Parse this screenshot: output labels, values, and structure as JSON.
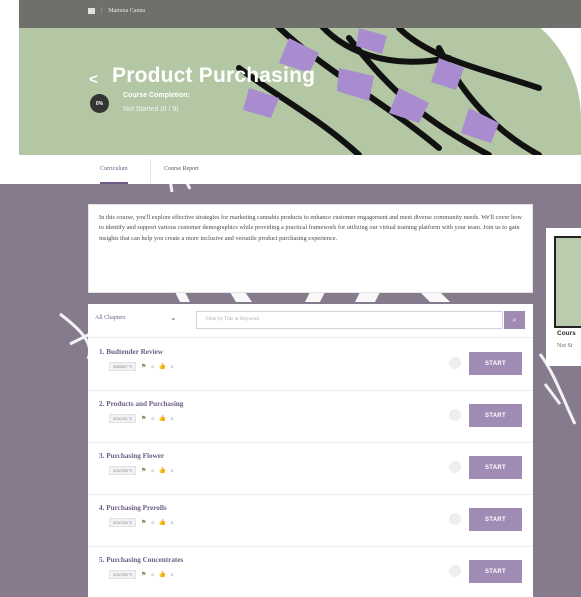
{
  "breadcrumb": {
    "site": "Mamma Canna"
  },
  "hero": {
    "back_label": "<",
    "title": "Product Purchasing",
    "progress_percent": "0%",
    "completion_label": "Course Completion:",
    "completion_status": "Not Started (0 / 9)"
  },
  "tabs": [
    {
      "label": "Curriculum",
      "active": true
    },
    {
      "label": "Course Report",
      "active": false
    }
  ],
  "description": "In this course, you'll explore effective strategies for marketing cannabis products to enhance customer engagement and meet diverse community needs. We'll cover how to identify and support various customer demographics while providing a practical framework for utilizing our virtual training platform with your team. Join us to gain insights that can help you create a more inclusive and versatile product purchasing experience.",
  "side_card": {
    "title": "Cours",
    "status": "Not St"
  },
  "filter": {
    "chapter_select": "All Chapters",
    "placeholder": "Filter by Title or Keyword"
  },
  "chapters": [
    {
      "title": "1. Budtender Review",
      "id": "3285807",
      "flag": "0",
      "likes": "0",
      "button": "START"
    },
    {
      "title": "2. Products and Purchasing",
      "id": "3240781",
      "flag": "0",
      "likes": "0",
      "button": "START"
    },
    {
      "title": "3. Purchasing Flower",
      "id": "3240783",
      "flag": "0",
      "likes": "0",
      "button": "START"
    },
    {
      "title": "4. Purchasing Prerolls",
      "id": "3240784",
      "flag": "0",
      "likes": "0",
      "button": "START"
    },
    {
      "title": "5. Purchasing Concentrates",
      "id": "3240785",
      "flag": "0",
      "likes": "0",
      "button": "START"
    }
  ],
  "colors": {
    "accent": "#a08bb5",
    "hero_bg": "#b3c7a4",
    "main_bg": "#857b8d"
  }
}
